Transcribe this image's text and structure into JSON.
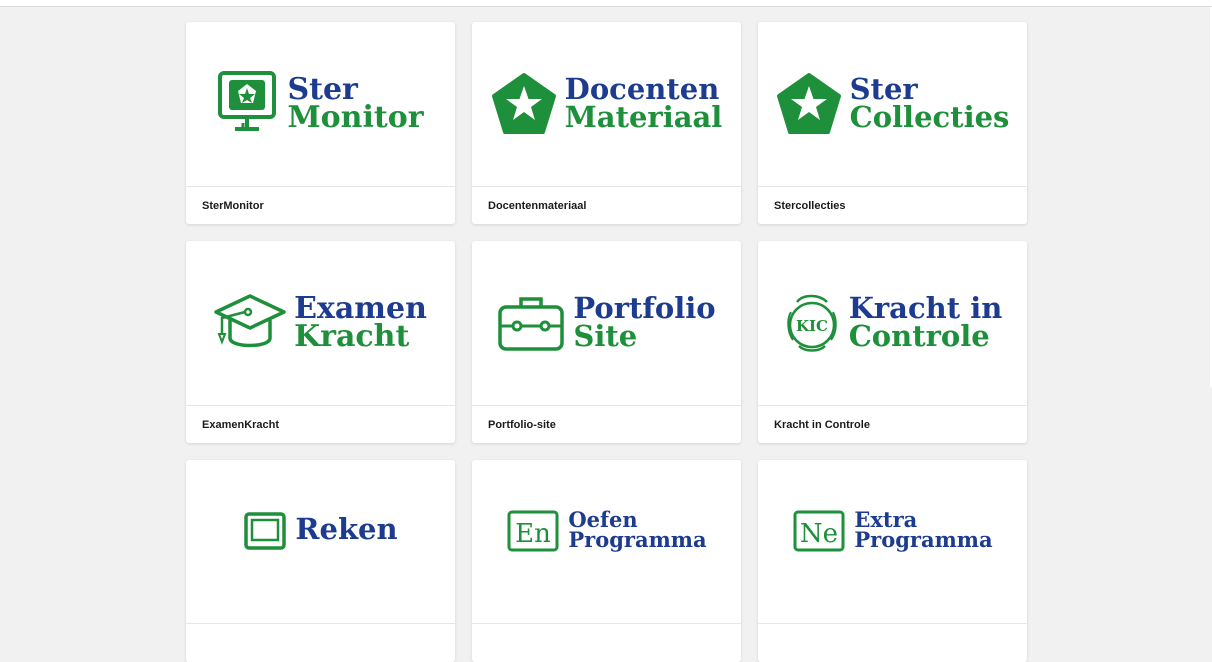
{
  "colors": {
    "brand_blue": "#1d3c8f",
    "brand_green": "#1e8f3a"
  },
  "tiles": [
    {
      "icon": "monitor-star-icon",
      "line1": "Ster",
      "line2": "Monitor",
      "caption": "SterMonitor"
    },
    {
      "icon": "pentagon-star-icon",
      "line1": "Docenten",
      "line2": "Materiaal",
      "caption": "Docentenmateriaal"
    },
    {
      "icon": "pentagon-star-icon",
      "line1": "Ster",
      "line2": "Collecties",
      "caption": "Stercollecties"
    },
    {
      "icon": "graduation-cap-icon",
      "line1": "Examen",
      "line2": "Kracht",
      "caption": "ExamenKracht"
    },
    {
      "icon": "briefcase-icon",
      "line1": "Portfolio",
      "line2": "Site",
      "caption": "Portfolio-site"
    },
    {
      "icon": "kic-globe-icon",
      "line1": "Kracht in",
      "line2": "Controle",
      "caption": "Kracht in Controle",
      "icon_letters": "KIC"
    },
    {
      "icon": "screen-icon",
      "line1": "Reken",
      "line2": "",
      "caption": ""
    },
    {
      "icon": "language-box-icon",
      "icon_letters": "En",
      "line1": "Oefen",
      "line2": "Programma",
      "caption": ""
    },
    {
      "icon": "language-box-icon",
      "icon_letters": "Ne",
      "line1": "Extra",
      "line2": "Programma",
      "caption": ""
    }
  ]
}
